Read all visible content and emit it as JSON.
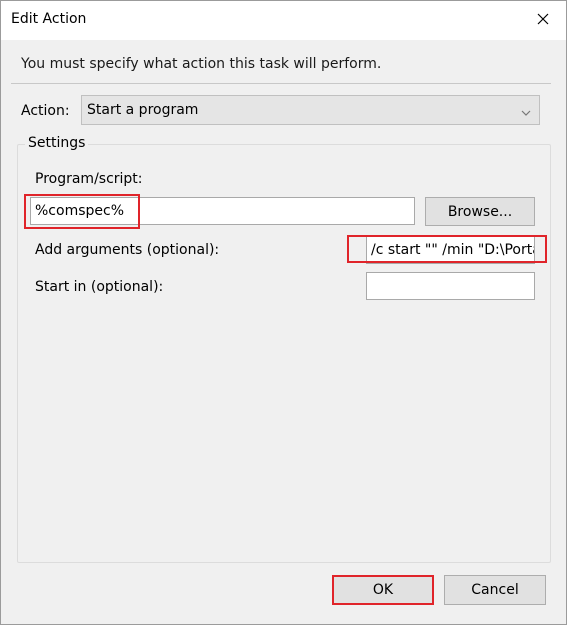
{
  "window": {
    "title": "Edit Action"
  },
  "icons": {
    "close": "close-icon",
    "dropdown": "chevron-down-icon"
  },
  "header": {
    "message": "You must specify what action this task will perform."
  },
  "action": {
    "label": "Action:",
    "selected": "Start a program"
  },
  "settings": {
    "title": "Settings",
    "program_label": "Program/script:",
    "program_value": "%comspec%",
    "browse_label": "Browse...",
    "arguments_label": "Add arguments (optional):",
    "arguments_value": "/c start \"\" /min \"D:\\Portab",
    "start_in_label": "Start in (optional):",
    "start_in_value": ""
  },
  "footer": {
    "ok_label": "OK",
    "cancel_label": "Cancel"
  },
  "colors": {
    "highlight": "#e0242a",
    "focus": "#0078d7"
  }
}
